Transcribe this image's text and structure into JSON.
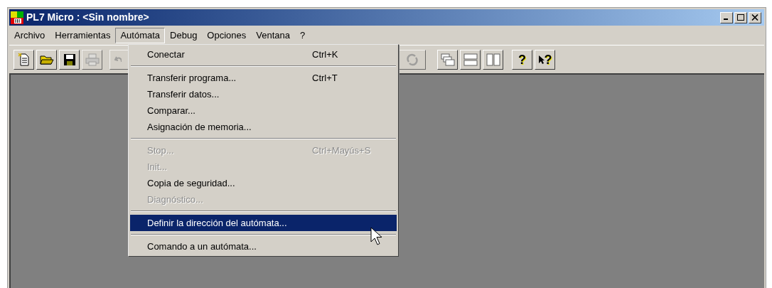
{
  "window": {
    "title": "PL7 Micro : <Sin nombre>"
  },
  "menu_bar": [
    {
      "label": "Archivo",
      "selected": false
    },
    {
      "label": "Herramientas",
      "selected": false
    },
    {
      "label": "Autómata",
      "selected": true
    },
    {
      "label": "Debug",
      "selected": false
    },
    {
      "label": "Opciones",
      "selected": false
    },
    {
      "label": "Ventana",
      "selected": false
    },
    {
      "label": "?",
      "selected": false
    }
  ],
  "toolbar": [
    {
      "kind": "new",
      "disabled": false
    },
    {
      "kind": "open",
      "disabled": false
    },
    {
      "kind": "save",
      "disabled": false
    },
    {
      "kind": "print",
      "disabled": true
    },
    {
      "kind": "undo",
      "disabled": true
    },
    {
      "kind": "refresh",
      "disabled": true
    },
    {
      "kind": "cascade",
      "disabled": false
    },
    {
      "kind": "tile-horizontal",
      "disabled": false
    },
    {
      "kind": "tile-vertical",
      "disabled": false
    },
    {
      "kind": "help",
      "disabled": false,
      "glyph": "?"
    },
    {
      "kind": "context-help",
      "disabled": false,
      "glyph": "?"
    }
  ],
  "dropdown": [
    {
      "kind": "item",
      "label": "Conectar",
      "shortcut": "Ctrl+K",
      "disabled": false,
      "selected": false
    },
    {
      "kind": "separator"
    },
    {
      "kind": "item",
      "label": "Transferir programa...",
      "shortcut": "Ctrl+T",
      "disabled": false,
      "selected": false
    },
    {
      "kind": "item",
      "label": "Transferir datos...",
      "disabled": false,
      "selected": false
    },
    {
      "kind": "item",
      "label": "Comparar...",
      "disabled": false,
      "selected": false
    },
    {
      "kind": "item",
      "label": "Asignación de memoria...",
      "disabled": false,
      "selected": false
    },
    {
      "kind": "separator"
    },
    {
      "kind": "item",
      "label": "Stop...",
      "shortcut": "Ctrl+Mayús+S",
      "disabled": true,
      "selected": false
    },
    {
      "kind": "item",
      "label": "Init...",
      "disabled": true,
      "selected": false
    },
    {
      "kind": "item",
      "label": "Copia de seguridad...",
      "disabled": false,
      "selected": false
    },
    {
      "kind": "item",
      "label": "Diagnóstico...",
      "disabled": true,
      "selected": false
    },
    {
      "kind": "separator"
    },
    {
      "kind": "item",
      "label": "Definir la dirección del autómata...",
      "disabled": false,
      "selected": true
    },
    {
      "kind": "separator"
    },
    {
      "kind": "item",
      "label": "Comando a un autómata...",
      "disabled": false,
      "selected": false
    }
  ]
}
